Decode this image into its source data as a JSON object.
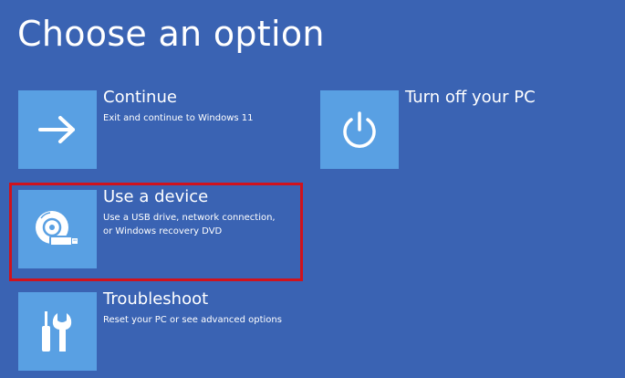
{
  "page": {
    "title": "Choose an option"
  },
  "options": [
    {
      "title": "Continue",
      "description": [
        "Exit and continue to Windows 11"
      ],
      "icon": "arrow-right-icon"
    },
    {
      "title": "Use a device",
      "description": [
        "Use a USB drive, network connection,",
        "or Windows recovery DVD"
      ],
      "icon": "disc-drive-icon",
      "highlighted": true
    },
    {
      "title": "Troubleshoot",
      "description": [
        "Reset your PC or see advanced options"
      ],
      "icon": "tools-icon"
    },
    {
      "title": "Turn off your PC",
      "description": [],
      "icon": "power-icon"
    }
  ],
  "colors": {
    "background": "#3a63b3",
    "tile": "#59a0e3",
    "highlight": "#d0121c",
    "text": "#ffffff"
  }
}
